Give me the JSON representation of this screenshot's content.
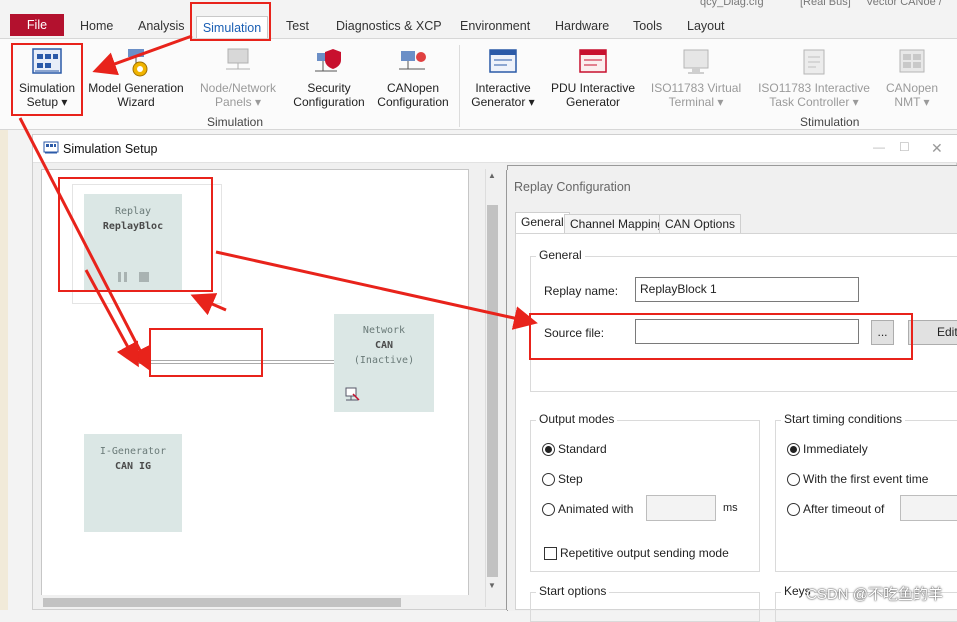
{
  "topbar": {
    "doc_title": "qcy_Diag.cfg",
    "bus_mode": "[Real Bus]",
    "app_name": "Vector CANoe /"
  },
  "tabs": [
    {
      "label": "File"
    },
    {
      "label": "Home"
    },
    {
      "label": "Analysis"
    },
    {
      "label": "Simulation"
    },
    {
      "label": "Test"
    },
    {
      "label": "Diagnostics & XCP"
    },
    {
      "label": "Environment"
    },
    {
      "label": "Hardware"
    },
    {
      "label": "Tools"
    },
    {
      "label": "Layout"
    }
  ],
  "ribbon": {
    "buttons": [
      {
        "line1": "Simulation",
        "line2": "Setup ▾",
        "icon": "simulation-setup-icon"
      },
      {
        "line1": "Model Generation",
        "line2": "Wizard",
        "icon": "model-generation-icon"
      },
      {
        "line1": "Node/Network",
        "line2": "Panels ▾",
        "icon": "node-network-panels-icon"
      },
      {
        "line1": "Security",
        "line2": "Configuration",
        "icon": "security-icon"
      },
      {
        "line1": "CANopen",
        "line2": "Configuration",
        "icon": "canopen-icon"
      },
      {
        "line1": "Interactive",
        "line2": "Generator ▾",
        "icon": "interactive-generator-icon"
      },
      {
        "line1": "PDU Interactive",
        "line2": "Generator",
        "icon": "pdu-generator-icon"
      },
      {
        "line1": "ISO11783 Virtual",
        "line2": "Terminal ▾",
        "icon": "virtual-terminal-icon"
      },
      {
        "line1": "ISO11783 Interactive",
        "line2": "Task Controller ▾",
        "icon": "task-controller-icon"
      },
      {
        "line1": "CANopen",
        "line2": "NMT ▾",
        "icon": "nmt-icon"
      }
    ],
    "groups": {
      "simulation": "Simulation",
      "stimulation": "Stimulation"
    }
  },
  "window": {
    "title": "Simulation Setup",
    "controls": [
      "—",
      "☐",
      "✕"
    ]
  },
  "canvas": {
    "replay": {
      "type": "Replay",
      "name": "ReplayBloc"
    },
    "network": {
      "type": "Network",
      "name": "CAN",
      "state": "(Inactive)"
    },
    "igen": {
      "type": "I-Generator",
      "name": "CAN IG"
    }
  },
  "dialog": {
    "title": "Replay Configuration",
    "tabs": [
      "General",
      "Channel Mapping",
      "CAN Options"
    ],
    "general_group": "General",
    "replay_name_label": "Replay name:",
    "replay_name_value": "ReplayBlock 1",
    "source_file_label": "Source file:",
    "source_file_value": "",
    "browse_label": "...",
    "edit_label": "Edit...",
    "output_modes": {
      "title": "Output modes",
      "standard": "Standard",
      "step": "Step",
      "animated": "Animated with",
      "ms": "ms",
      "repetitive": "Repetitive output sending mode"
    },
    "start_timing": {
      "title": "Start timing conditions",
      "immediately": "Immediately",
      "first_event": "With the first event time",
      "after_timeout": "After timeout of"
    },
    "start_options": "Start options",
    "keys": "Keys"
  },
  "watermark": "CSDN @不吃鱼的羊",
  "colors": {
    "accent": "#1a5fb4",
    "file_tab": "#b3112e",
    "annotation_red": "#e8231b",
    "block_fill": "#dbe7e5"
  }
}
